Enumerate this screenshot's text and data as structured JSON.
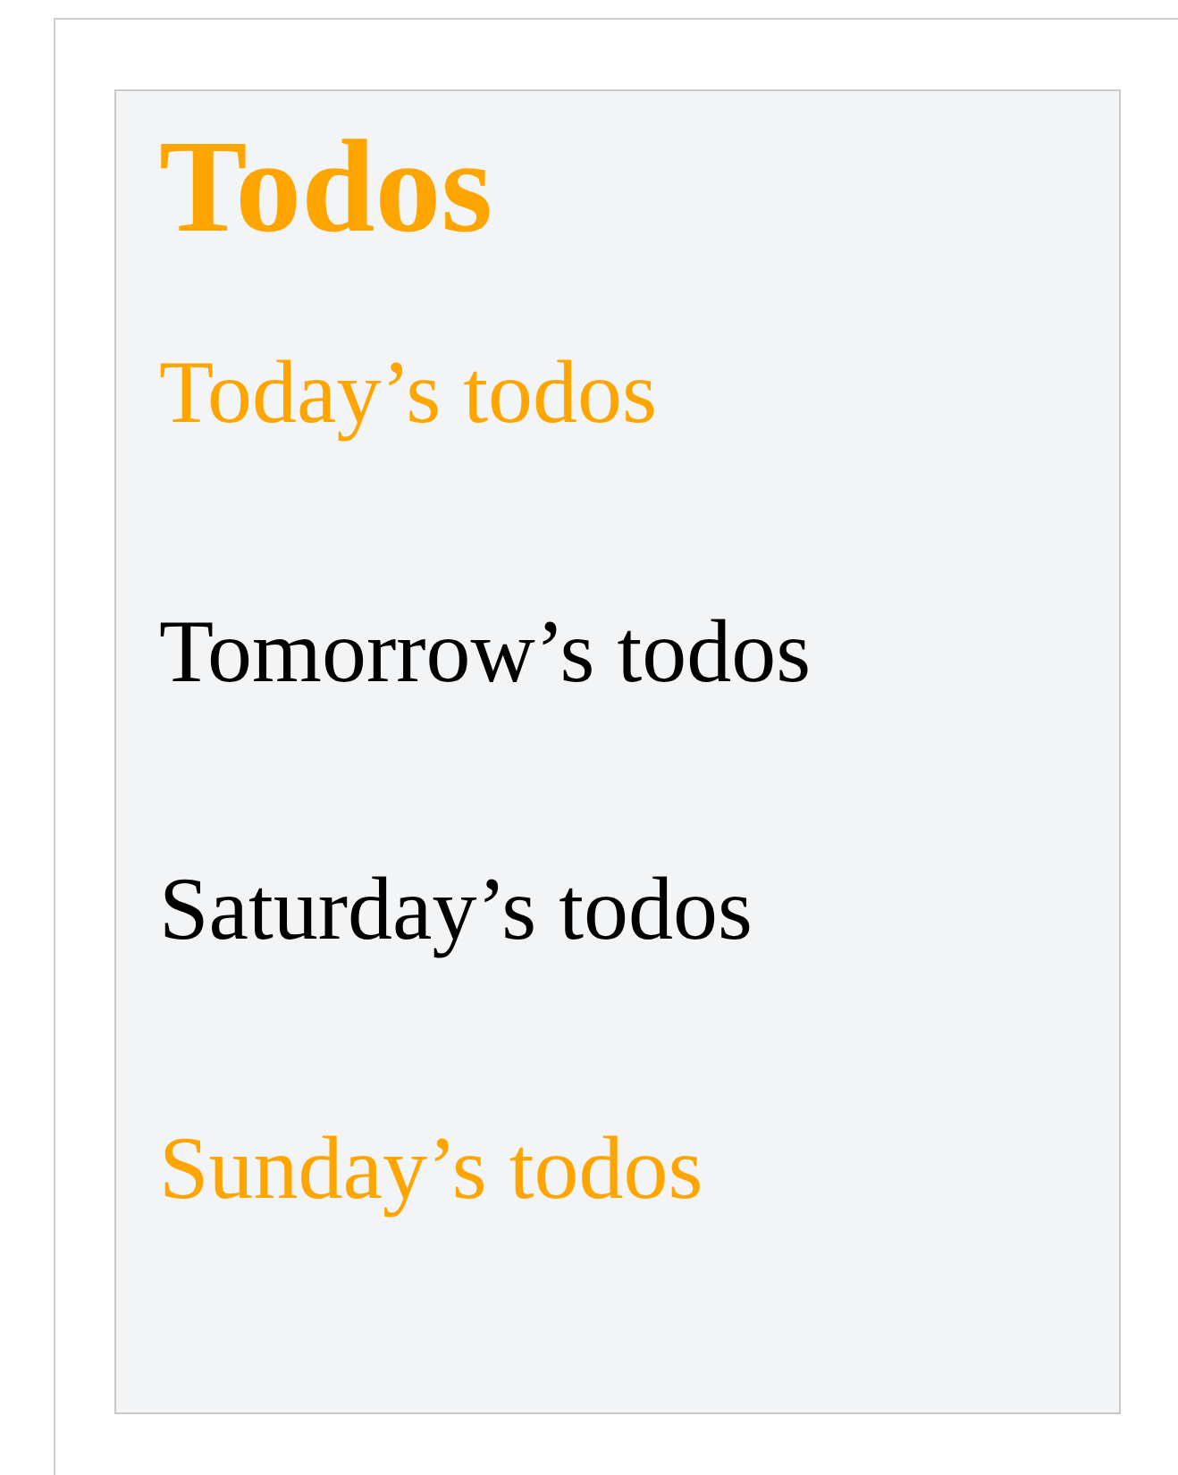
{
  "title": "Todos",
  "lists": [
    {
      "label": "Today’s todos",
      "highlighted": true
    },
    {
      "label": "Tomorrow’s todos",
      "highlighted": false
    },
    {
      "label": "Saturday’s todos",
      "highlighted": false
    },
    {
      "label": "Sunday’s todos",
      "highlighted": true
    }
  ]
}
